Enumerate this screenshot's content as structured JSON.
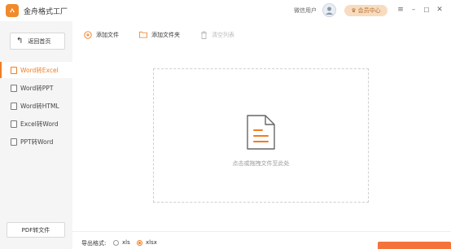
{
  "app": {
    "title": "金舟格式工厂"
  },
  "header": {
    "user_name": "微信用户",
    "vip_label": "会员中心"
  },
  "window_controls": {
    "menu": "≡",
    "minimize": "–",
    "maximize": "☐",
    "close": "✕"
  },
  "sidebar": {
    "home_label": "返回首页",
    "items": [
      {
        "label": "Word转Excel",
        "active": true
      },
      {
        "label": "Word转PPT",
        "active": false
      },
      {
        "label": "Word转HTML",
        "active": false
      },
      {
        "label": "Excel转Word",
        "active": false
      },
      {
        "label": "PPT转Word",
        "active": false
      }
    ],
    "pdf_button": "PDF转文件"
  },
  "toolbar": {
    "add_file": "添加文件",
    "add_folder": "添加文件夹",
    "clear_list": "清空列表"
  },
  "dropzone": {
    "hint": "点击或拖拽文件至此处"
  },
  "footer": {
    "format_label": "导出格式:",
    "options": [
      {
        "label": "xls",
        "selected": false
      },
      {
        "label": "xlsx",
        "selected": true
      }
    ]
  },
  "colors": {
    "accent": "#f07d22",
    "start_button": "#f4733b"
  }
}
